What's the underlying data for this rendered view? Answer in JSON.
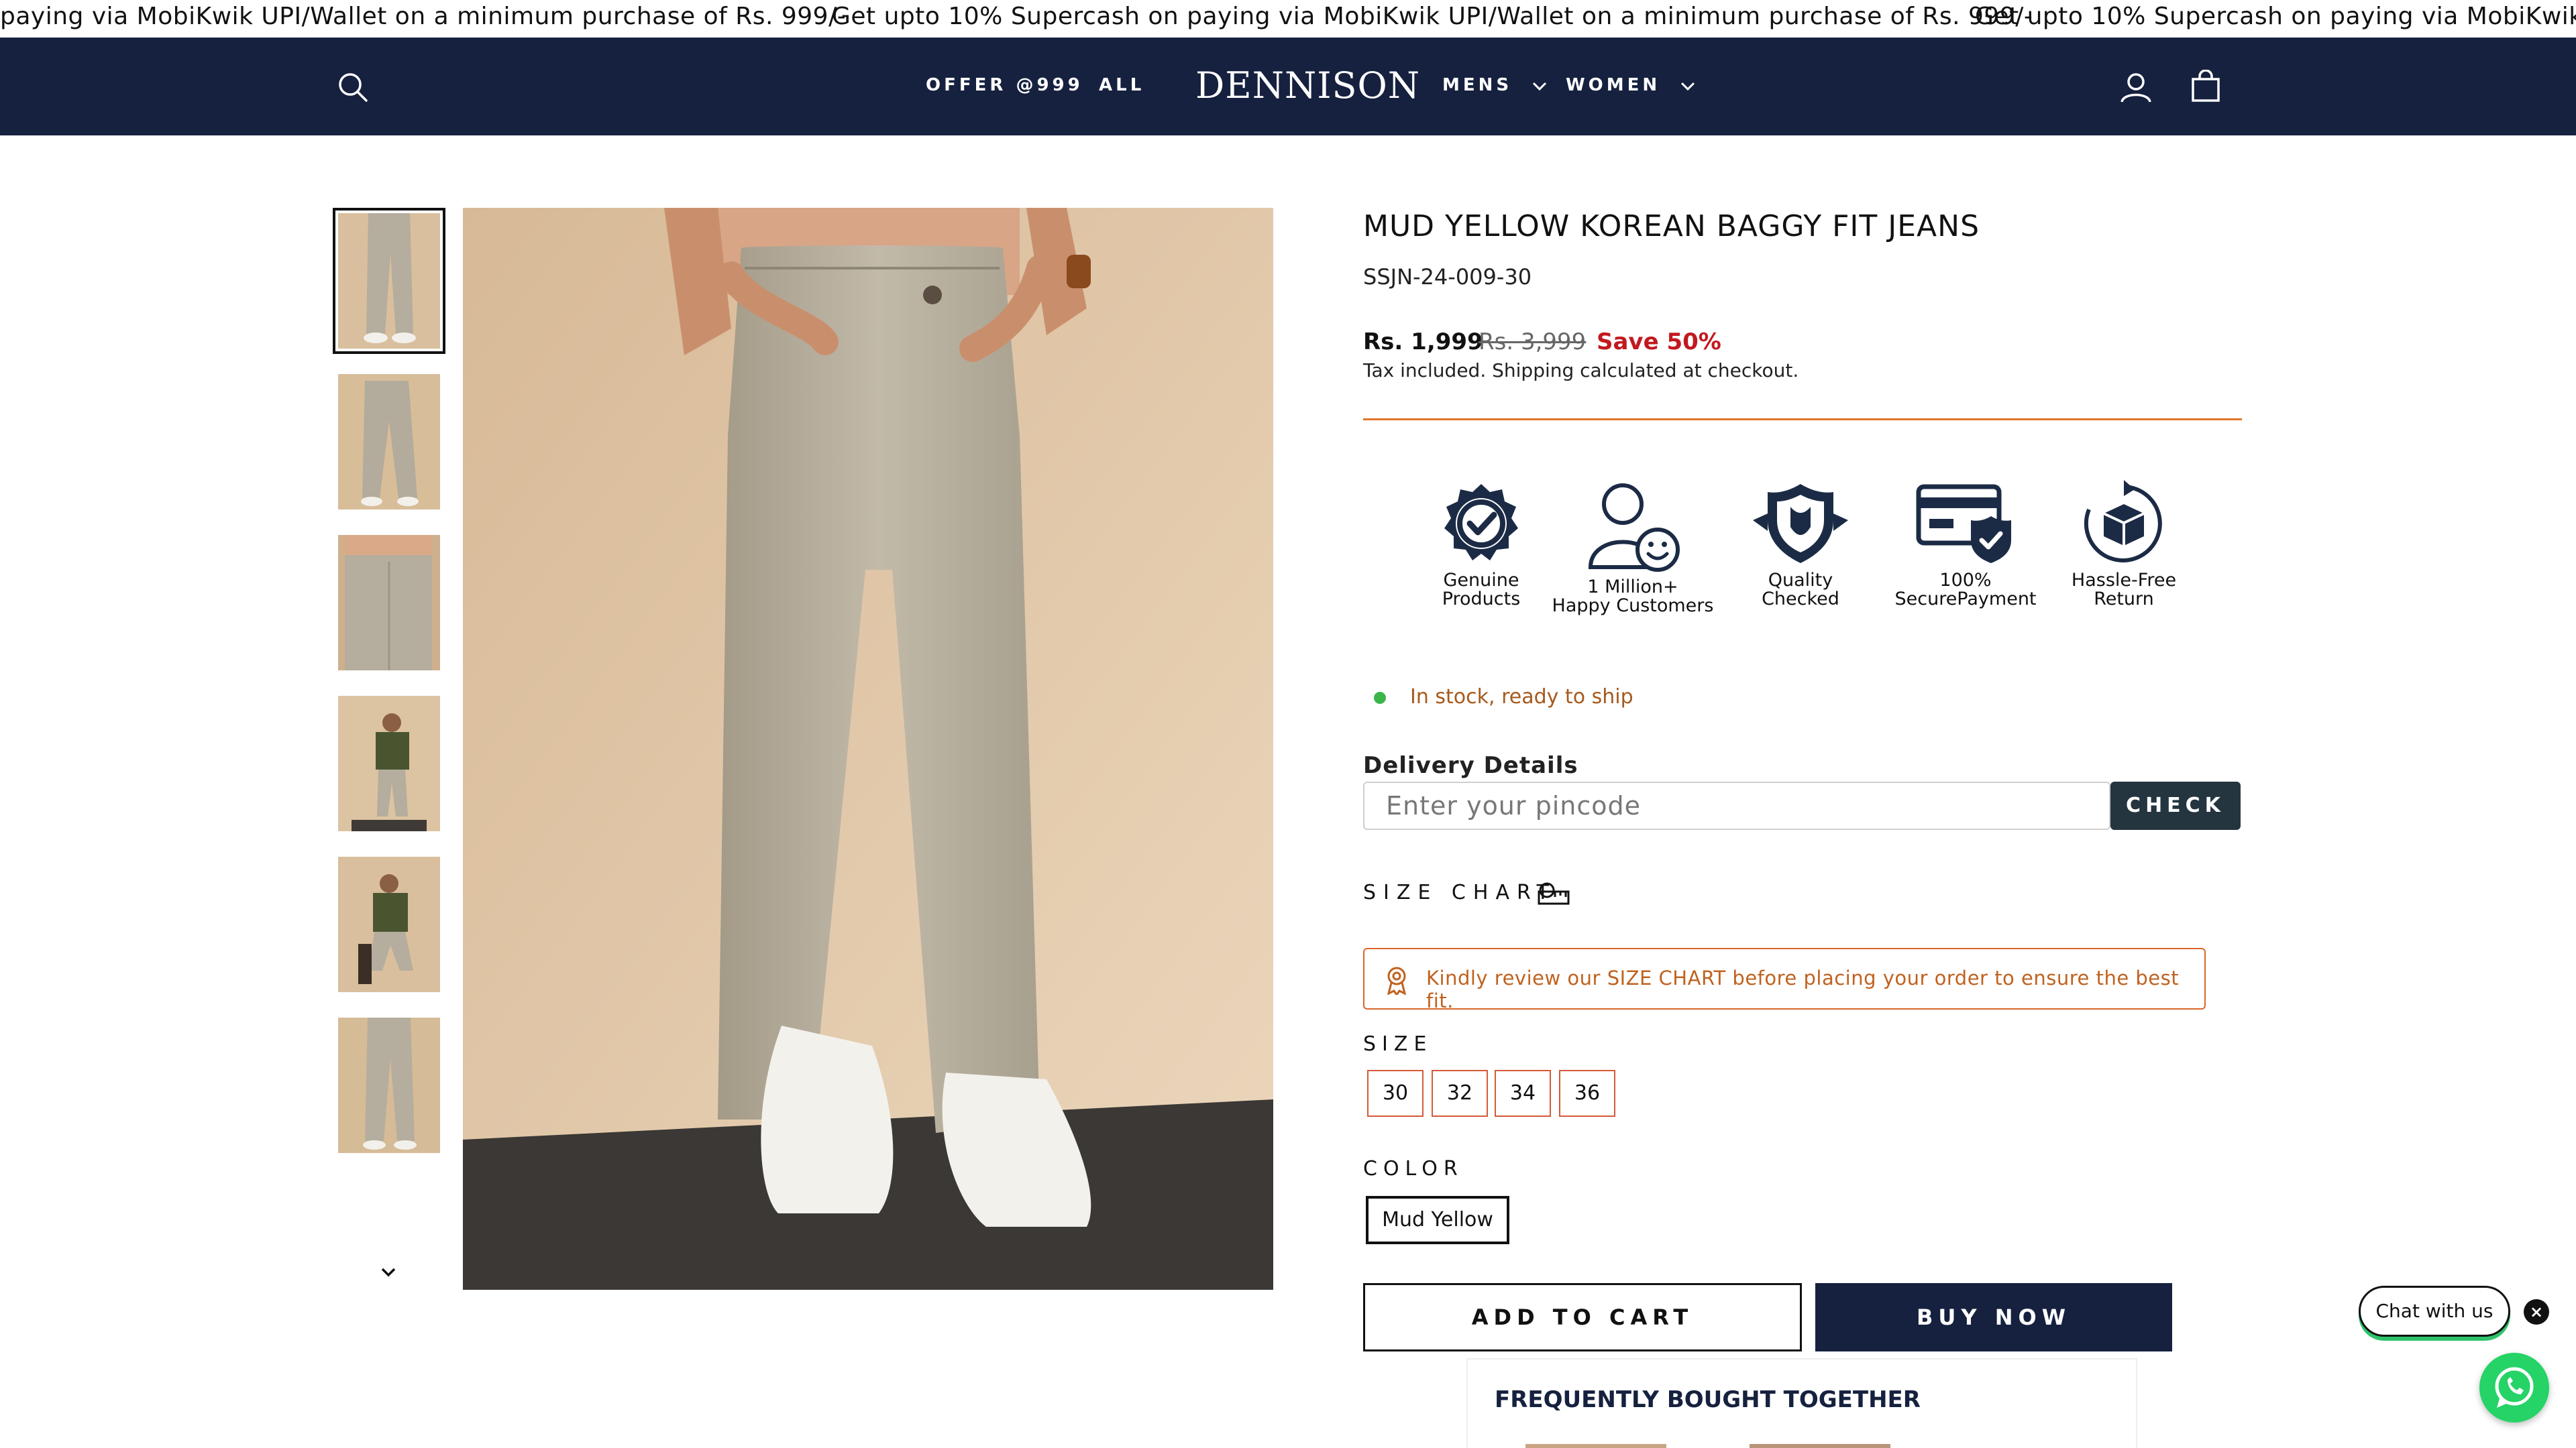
{
  "announcement": {
    "segments": [
      "paying via MobiKwik UPI/Wallet on a minimum purchase of Rs. 999/-",
      "Get upto 10% Supercash on paying via MobiKwik UPI/Wallet on a minimum purchase of Rs. 999/-",
      "Get upto 10% Supercash on paying via MobiKwik UPI/"
    ]
  },
  "header": {
    "logo": "DENNISON",
    "nav": [
      "OFFER @999",
      "ALL",
      "MENS",
      "WOMEN"
    ],
    "icons": [
      "search-icon",
      "account-icon",
      "cart-icon"
    ]
  },
  "product": {
    "title": "MUD YELLOW KOREAN BAGGY FIT JEANS",
    "sku": "SSJN-24-009-30",
    "price": "Rs. 1,999",
    "compare_price": "Rs. 3,999",
    "save": "Save 50%",
    "tax_note": "Tax included. Shipping calculated at checkout.",
    "badges": [
      {
        "line1": "Genuine",
        "line2": "Products",
        "icon": "verified-check-icon"
      },
      {
        "line1": "1 Million+",
        "line2": "Happy Customers",
        "icon": "happy-customer-icon"
      },
      {
        "line1": "Quality",
        "line2": "Checked",
        "icon": "quality-shield-icon"
      },
      {
        "line1": "100%",
        "line2": "SecurePayment",
        "icon": "secure-payment-icon"
      },
      {
        "line1": "Hassle-Free",
        "line2": "Return",
        "icon": "return-box-icon"
      }
    ],
    "stock_status": "In stock, ready to ship",
    "delivery_label": "Delivery Details",
    "pincode_placeholder": "Enter your pincode",
    "check_label": "CHECK",
    "size_chart_label": "SIZE CHART",
    "size_notice": "Kindly review our SIZE CHART before placing your order to ensure the best fit.",
    "size_label": "SIZE",
    "sizes": [
      "30",
      "32",
      "34",
      "36"
    ],
    "color_label": "COLOR",
    "color_selected": "Mud Yellow",
    "add_to_cart": "ADD TO CART",
    "buy_now": "BUY NOW",
    "fbt_heading": "FREQUENTLY BOUGHT TOGETHER"
  },
  "chat": {
    "label": "Chat with us",
    "close": "×"
  },
  "colors": {
    "brand_navy": "#16213f",
    "save_red": "#c2191f",
    "accent_orange": "#e0762c",
    "stock_green": "#3bb54a",
    "whatsapp_green": "#25d366"
  }
}
